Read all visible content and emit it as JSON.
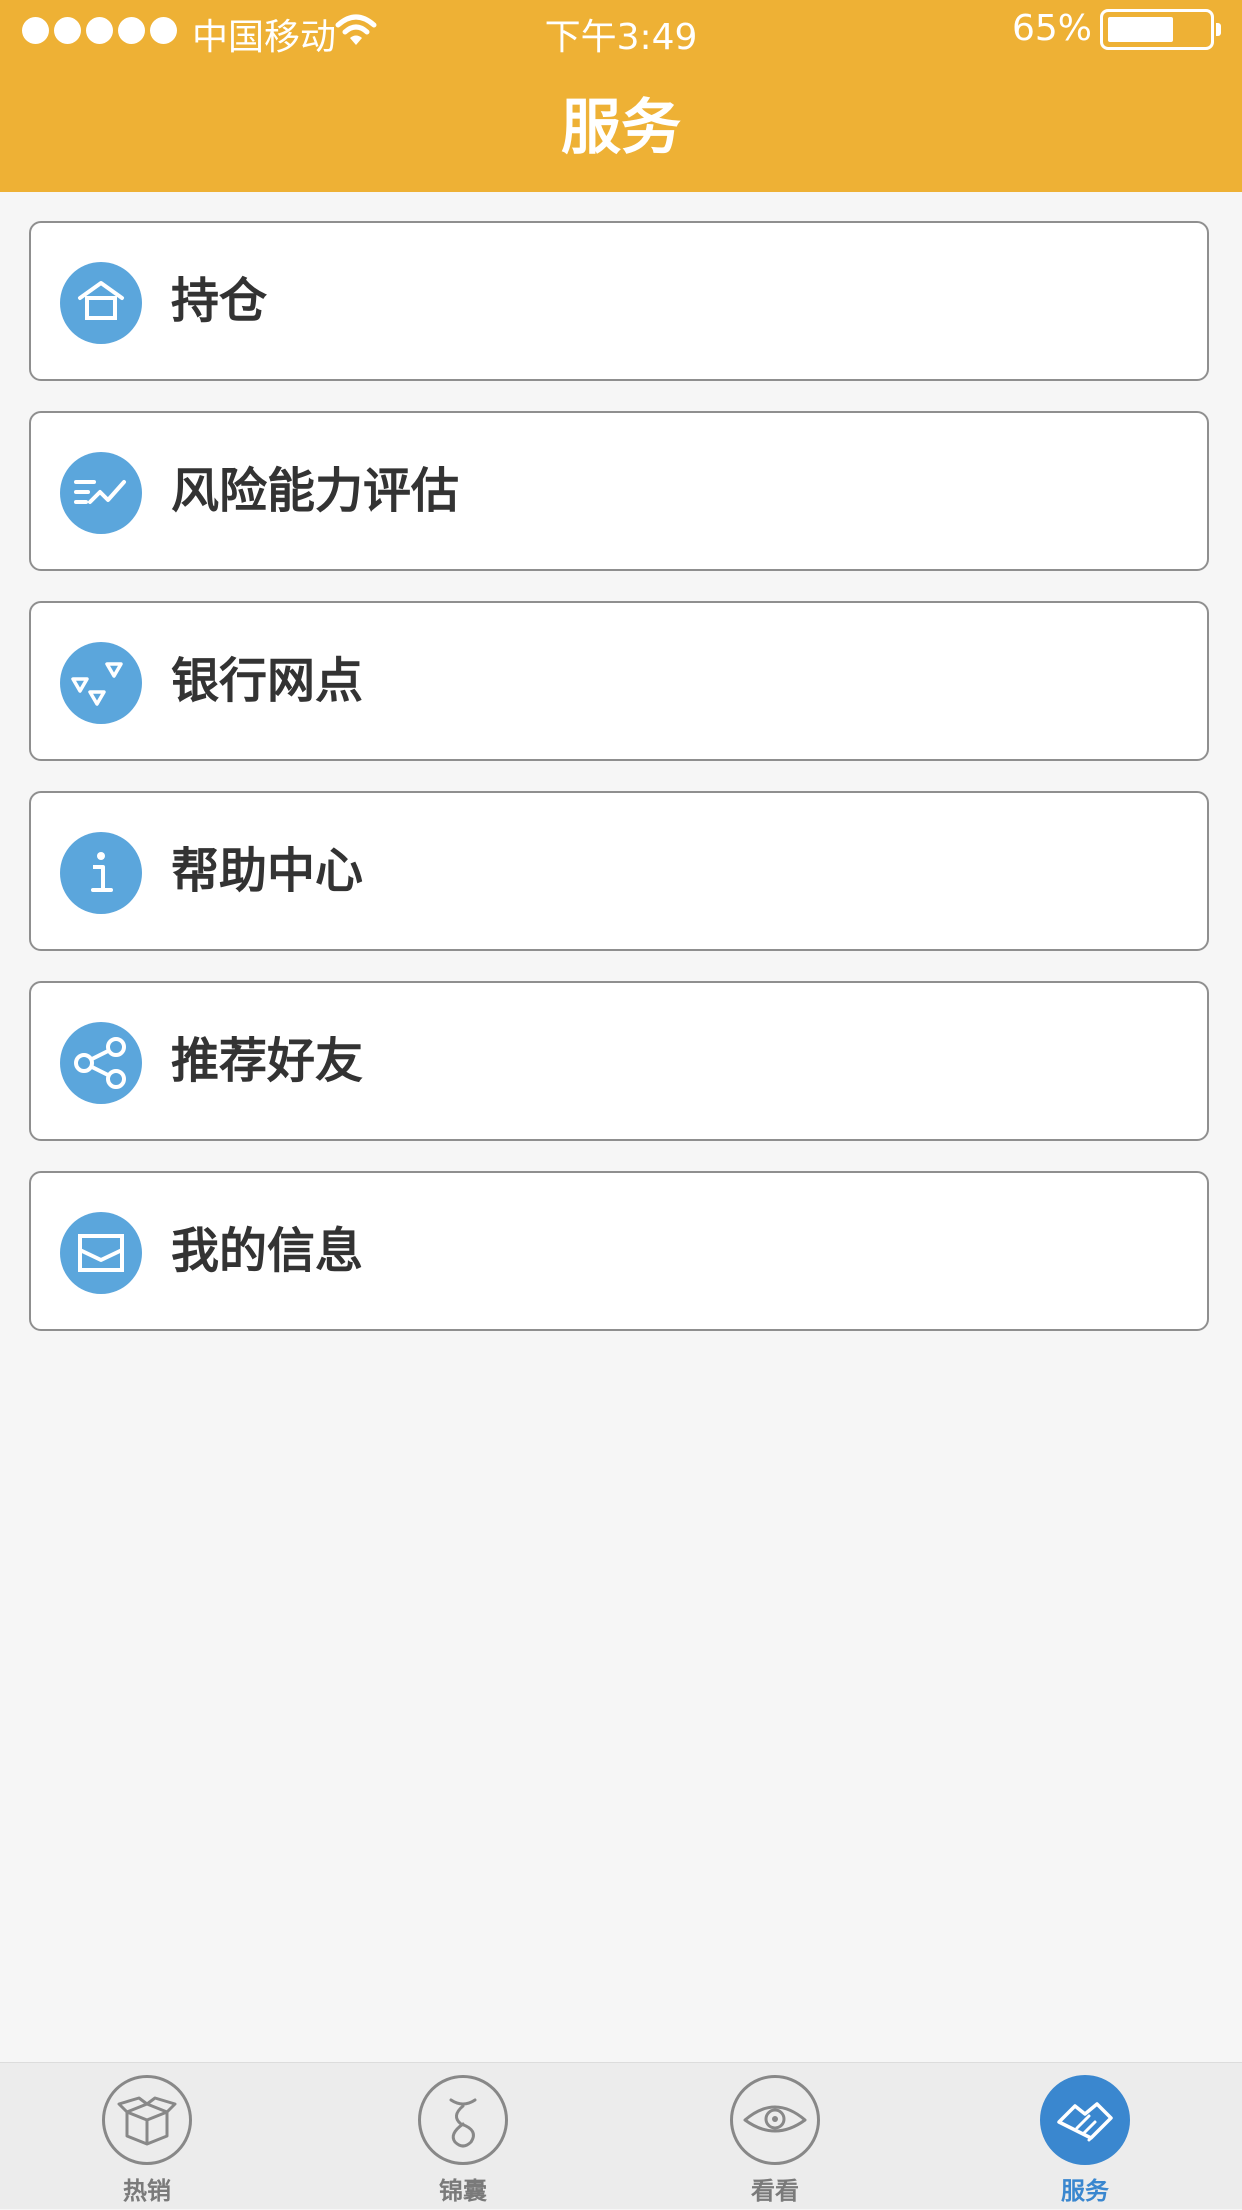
{
  "status_bar": {
    "carrier": "中国移动",
    "time": "下午3:49",
    "battery": "65%"
  },
  "header": {
    "title": "服务"
  },
  "menu": [
    {
      "label": "持仓",
      "icon": "house-icon"
    },
    {
      "label": "风险能力评估",
      "icon": "trend-icon"
    },
    {
      "label": "银行网点",
      "icon": "triangles-icon"
    },
    {
      "label": "帮助中心",
      "icon": "info-icon"
    },
    {
      "label": "推荐好友",
      "icon": "share-icon"
    },
    {
      "label": "我的信息",
      "icon": "envelope-icon"
    }
  ],
  "tabs": [
    {
      "label": "热销",
      "icon": "box-icon"
    },
    {
      "label": "锦囊",
      "icon": "pouch-icon"
    },
    {
      "label": "看看",
      "icon": "eye-icon"
    },
    {
      "label": "服务",
      "icon": "handshake-icon",
      "active": true
    }
  ],
  "colors": {
    "header_bg": "#eeb135",
    "icon_bg": "#5ba6dc",
    "tab_active": "#3a87cf"
  }
}
